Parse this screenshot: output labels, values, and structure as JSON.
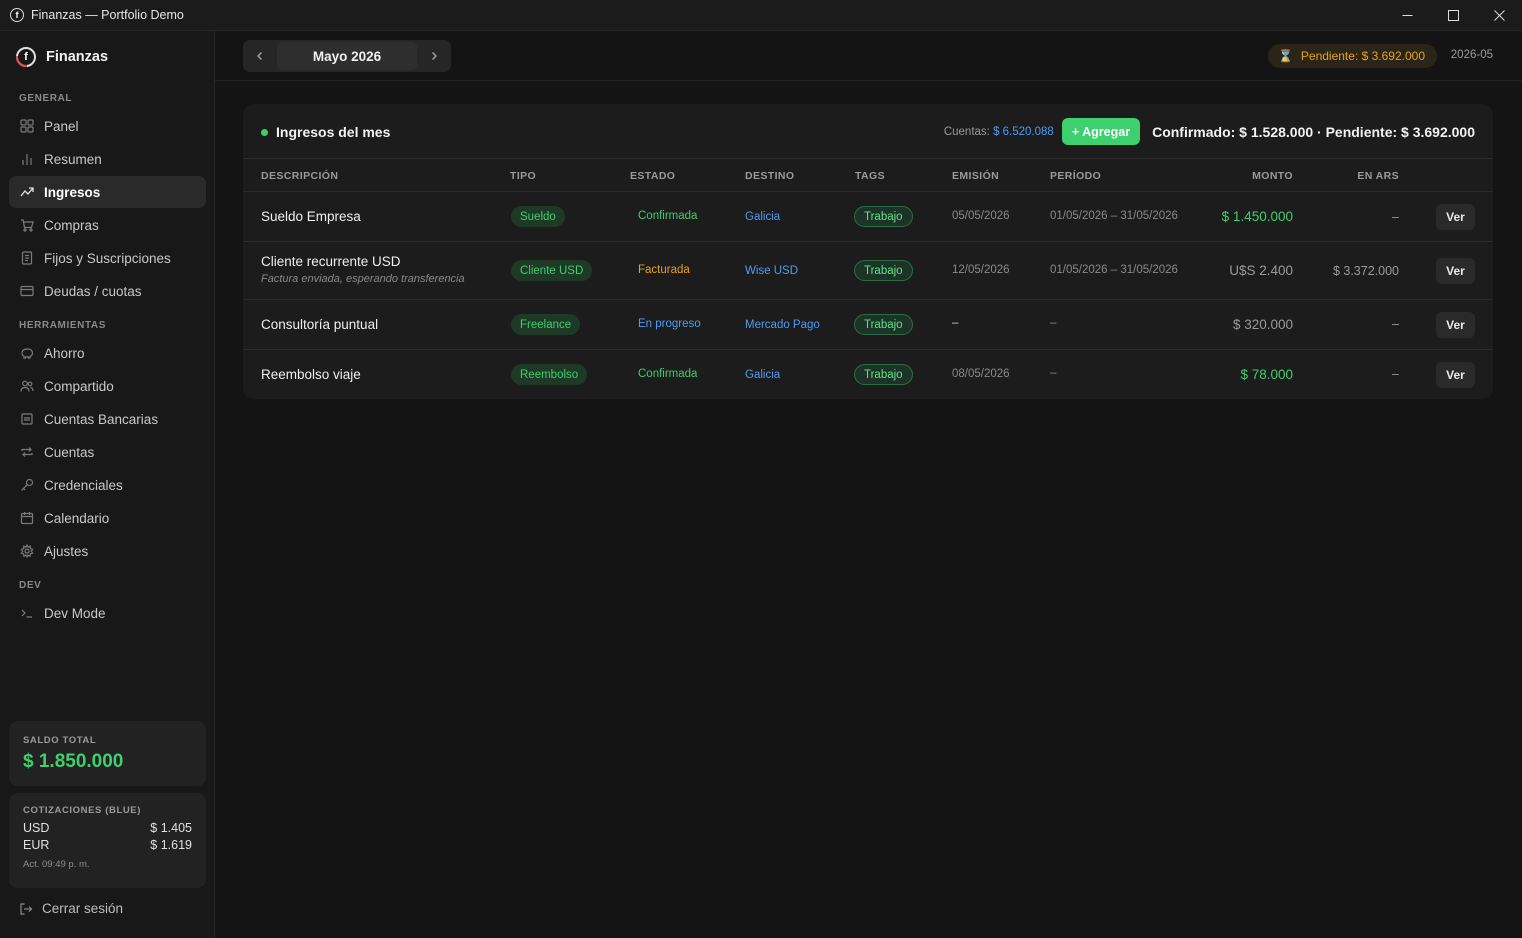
{
  "window": {
    "title": "Finanzas — Portfolio Demo",
    "icon": "finanzas-app-icon"
  },
  "sidebar": {
    "brand": "Finanzas",
    "sections": {
      "general": "GENERAL",
      "herramientas": "HERRAMIENTAS",
      "dev": "DEV"
    },
    "items": [
      {
        "label": "Panel",
        "icon": "grid-icon",
        "active": false
      },
      {
        "label": "Resumen",
        "icon": "bar-chart-icon",
        "active": false
      },
      {
        "label": "Ingresos",
        "icon": "trend-up-icon",
        "active": true
      },
      {
        "label": "Compras",
        "icon": "cart-icon",
        "active": false
      },
      {
        "label": "Fijos y Suscripciones",
        "icon": "receipt-icon",
        "active": false
      },
      {
        "label": "Deudas / cuotas",
        "icon": "credit-card-icon",
        "active": false
      },
      {
        "label": "Ahorro",
        "icon": "piggy-bank-icon",
        "active": false
      },
      {
        "label": "Compartido",
        "icon": "users-icon",
        "active": false
      },
      {
        "label": "Cuentas Bancarias",
        "icon": "bank-icon",
        "active": false
      },
      {
        "label": "Cuentas",
        "icon": "repeat-icon",
        "active": false
      },
      {
        "label": "Credenciales",
        "icon": "key-icon",
        "active": false
      },
      {
        "label": "Calendario",
        "icon": "calendar-icon",
        "active": false
      },
      {
        "label": "Ajustes",
        "icon": "gear-icon",
        "active": false
      },
      {
        "label": "Dev Mode",
        "icon": "terminal-icon",
        "active": false
      }
    ],
    "saldo": {
      "label": "SALDO TOTAL",
      "value": "$ 1.850.000"
    },
    "cotizaciones": {
      "label": "COTIZACIONES (BLUE)",
      "rates": [
        {
          "currency": "USD",
          "value": "$ 1.405"
        },
        {
          "currency": "EUR",
          "value": "$ 1.619"
        }
      ],
      "updated": "Act. 09:49 p. m."
    },
    "logout": "Cerrar sesión"
  },
  "topbar": {
    "month": "Mayo 2026",
    "pending": "Pendiente: $ 3.692.000",
    "period": "2026-05"
  },
  "panel": {
    "title": "Ingresos del mes",
    "cuentas_label": "Cuentas:",
    "cuentas_value": "$ 6.520.088",
    "add_button": "+ Agregar",
    "summary": "Confirmado: $ 1.528.000 · Pendiente: $ 3.692.000",
    "columns": [
      "DESCRIPCIÓN",
      "TIPO",
      "ESTADO",
      "DESTINO",
      "TAGS",
      "EMISIÓN",
      "PERÍODO",
      "MONTO",
      "EN ARS"
    ],
    "rows": [
      {
        "desc": "Sueldo Empresa",
        "sub": "",
        "tipo": "Sueldo",
        "estado": "Confirmada",
        "estado_color": "green",
        "destino": "Galicia",
        "tag": "Trabajo",
        "emision": "05/05/2026",
        "periodo": "01/05/2026 – 31/05/2026",
        "monto": "$ 1.450.000",
        "monto_color": "green",
        "ars": "–",
        "action": "Ver"
      },
      {
        "desc": "Cliente recurrente USD",
        "sub": "Factura enviada, esperando transferencia",
        "tipo": "Cliente USD",
        "estado": "Facturada",
        "estado_color": "orange",
        "destino": "Wise USD",
        "tag": "Trabajo",
        "emision": "12/05/2026",
        "periodo": "01/05/2026 – 31/05/2026",
        "monto": "U$S 2.400",
        "monto_color": "muted",
        "ars": "$ 3.372.000",
        "action": "Ver"
      },
      {
        "desc": "Consultoría puntual",
        "sub": "",
        "tipo": "Freelance",
        "estado": "En progreso",
        "estado_color": "blue",
        "destino": "Mercado Pago",
        "tag": "Trabajo",
        "emision": "–",
        "periodo": "–",
        "monto": "$ 320.000",
        "monto_color": "muted",
        "ars": "–",
        "action": "Ver"
      },
      {
        "desc": "Reembolso viaje",
        "sub": "",
        "tipo": "Reembolso",
        "estado": "Confirmada",
        "estado_color": "green",
        "destino": "Galicia",
        "tag": "Trabajo",
        "emision": "08/05/2026",
        "periodo": "–",
        "monto": "$ 78.000",
        "monto_color": "green",
        "ars": "–",
        "action": "Ver"
      }
    ]
  }
}
